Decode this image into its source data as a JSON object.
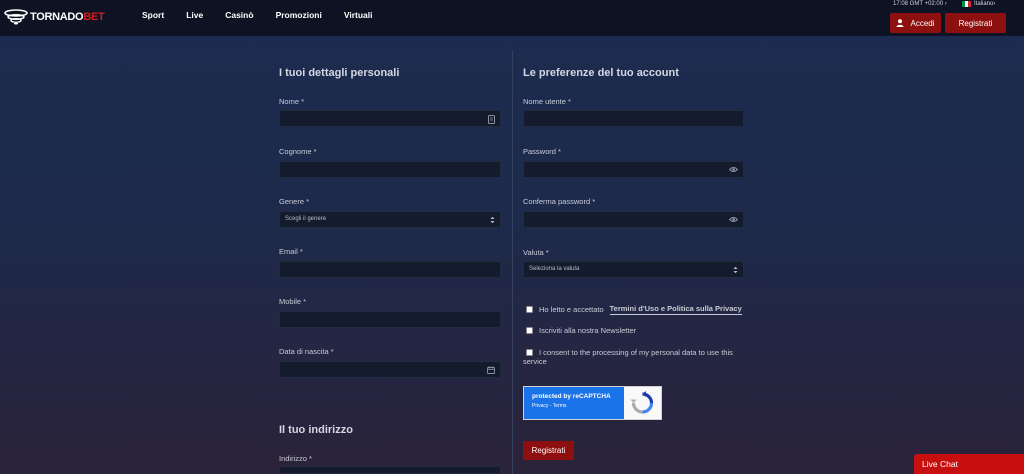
{
  "brand": {
    "name_part1": "TORNADO",
    "name_part2": "BET",
    "accent": "#d21e1e"
  },
  "nav": [
    "Sport",
    "Live",
    "Casinò",
    "Promozioni",
    "Virtuali"
  ],
  "topbar": {
    "time": "17:08 GMT +02:00",
    "language": "Italiano",
    "login_label": "Accedi",
    "register_label": "Registrati"
  },
  "personal": {
    "title": "I tuoi dettagli personali",
    "first_name_label": "Nome *",
    "last_name_label": "Cognome *",
    "gender_label": "Genere *",
    "gender_placeholder": "Scegli il genere",
    "email_label": "Email *",
    "mobile_label": "Mobile *",
    "birth_date_label": "Data di nascita *"
  },
  "address": {
    "title": "Il tuo indirizzo",
    "street_label": "Indirizzo *"
  },
  "account": {
    "title": "Le preferenze del tuo account",
    "username_label": "Nome utente *",
    "password_label": "Password *",
    "confirm_password_label": "Conferma password *",
    "currency_label": "Valuta *",
    "currency_placeholder": "Seleziona la valuta"
  },
  "consents": {
    "terms_text": "Ho letto e accettato",
    "terms_link": "Termini d'Uso e Politica sulla Privacy",
    "newsletter_text": "Iscriviti alla nostra Newsletter",
    "data_consent_line1": "I consent to the processing of my personal data to use this",
    "data_consent_line2": "service"
  },
  "recaptcha": {
    "title": "protected by reCAPTCHA",
    "links": "Privacy - Terms"
  },
  "submit_label": "Registrati",
  "live_chat_label": "Live Chat",
  "icons": {
    "contact_card": "contact-card-icon",
    "eye": "eye-icon",
    "select_arrows": "select-arrows-icon",
    "calendar": "calendar-icon",
    "user": "user-icon",
    "chevron_right": "chevron-right-icon"
  },
  "colors": {
    "topbar_bg": "#0d1322",
    "button_red": "#8d0f0f",
    "live_chat_red": "#c80f0f",
    "input_bg": "#141b2c"
  }
}
